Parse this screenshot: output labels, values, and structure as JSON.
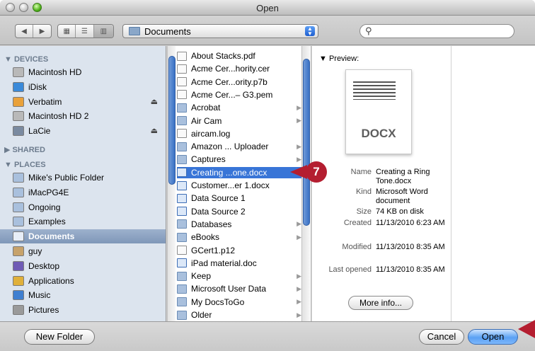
{
  "window": {
    "title": "Open"
  },
  "toolbar": {
    "location": "Documents",
    "search_placeholder": ""
  },
  "sidebar": {
    "devices_header": "▼ DEVICES",
    "devices": [
      {
        "label": "Macintosh HD",
        "icon": "hard-drive-icon"
      },
      {
        "label": "iDisk",
        "icon": "idisk-icon"
      },
      {
        "label": "Verbatim",
        "icon": "usb-drive-icon",
        "eject": true
      },
      {
        "label": "Macintosh HD 2",
        "icon": "hard-drive-icon"
      },
      {
        "label": "LaCie",
        "icon": "external-drive-icon",
        "eject": true
      }
    ],
    "shared_header": "▶ SHARED",
    "places_header": "▼ PLACES",
    "places": [
      {
        "label": "Mike's Public Folder",
        "icon": "folder-icon"
      },
      {
        "label": "iMacPG4E",
        "icon": "folder-icon"
      },
      {
        "label": "Ongoing",
        "icon": "folder-icon"
      },
      {
        "label": "Examples",
        "icon": "folder-icon"
      },
      {
        "label": "Documents",
        "icon": "documents-folder-icon",
        "selected": true
      },
      {
        "label": "guy",
        "icon": "home-icon"
      },
      {
        "label": "Desktop",
        "icon": "desktop-icon"
      },
      {
        "label": "Applications",
        "icon": "applications-icon"
      },
      {
        "label": "Music",
        "icon": "music-icon"
      },
      {
        "label": "Pictures",
        "icon": "pictures-icon"
      }
    ]
  },
  "files": [
    {
      "name": "About Stacks.pdf",
      "kind": "file"
    },
    {
      "name": "Acme Cer...hority.cer",
      "kind": "file"
    },
    {
      "name": "Acme Cer...ority.p7b",
      "kind": "file"
    },
    {
      "name": "Acme Cer...– G3.pem",
      "kind": "file"
    },
    {
      "name": "Acrobat",
      "kind": "folder"
    },
    {
      "name": "Air Cam",
      "kind": "folder"
    },
    {
      "name": "aircam.log",
      "kind": "file"
    },
    {
      "name": "Amazon ... Uploader",
      "kind": "folder"
    },
    {
      "name": "Captures",
      "kind": "folder"
    },
    {
      "name": "Creating ...one.docx",
      "kind": "word",
      "selected": true
    },
    {
      "name": "Customer...er 1.docx",
      "kind": "word"
    },
    {
      "name": "Data Source 1",
      "kind": "word"
    },
    {
      "name": "Data Source 2",
      "kind": "word"
    },
    {
      "name": "Databases",
      "kind": "folder"
    },
    {
      "name": "eBooks",
      "kind": "folder"
    },
    {
      "name": "GCert1.p12",
      "kind": "file"
    },
    {
      "name": "iPad material.doc",
      "kind": "word"
    },
    {
      "name": "Keep",
      "kind": "folder"
    },
    {
      "name": "Microsoft User Data",
      "kind": "folder"
    },
    {
      "name": "My DocsToGo",
      "kind": "folder"
    },
    {
      "name": "Older",
      "kind": "folder"
    }
  ],
  "preview": {
    "label": "▼ Preview:",
    "doc_type": "DOCX",
    "meta": [
      {
        "key": "Name",
        "value": "Creating a Ring Tone.docx"
      },
      {
        "key": "Kind",
        "value": "Microsoft Word document"
      },
      {
        "key": "Size",
        "value": "74 KB on disk"
      },
      {
        "key": "Created",
        "value": "11/13/2010 6:23 AM"
      },
      {
        "key": "Modified",
        "value": "11/13/2010 8:35 AM"
      },
      {
        "key": "Last opened",
        "value": "11/13/2010 8:35 AM"
      }
    ],
    "more_info": "More info..."
  },
  "buttons": {
    "new_folder": "New Folder",
    "cancel": "Cancel",
    "open": "Open"
  },
  "callout": {
    "step": "7"
  },
  "colors": {
    "selection": "#3875d7",
    "callout": "#b41e30",
    "sidebar": "#dce4ee"
  }
}
